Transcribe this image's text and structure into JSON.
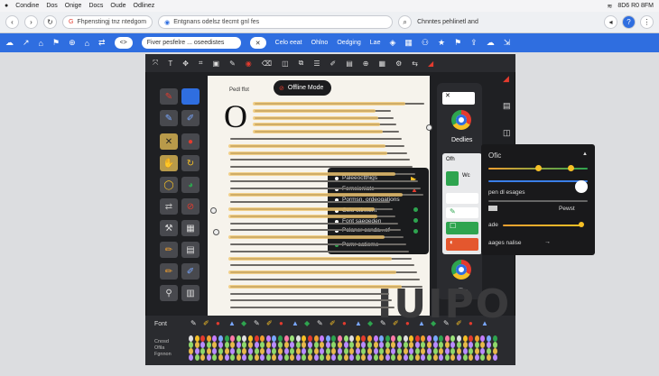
{
  "os_menu": {
    "items": [
      "Condine",
      "Dos",
      "Onige",
      "Docs",
      "Oude",
      "Odlinez"
    ],
    "status": "8D6 R0 8FM"
  },
  "address_bar": {
    "tab_text": "Fhpenstingj tnz ntedgom",
    "url": "Entgnans odelsz tlecmt gnl fes",
    "tab2_text": "Chnntes pehlinetl and"
  },
  "blue_toolbar": {
    "search_text": "Fiver pesfelre ... oseedistes",
    "labels": [
      "Celo eeat",
      "Ohlno",
      "Oedging",
      "Lae"
    ]
  },
  "document": {
    "header": "Pedl ffot",
    "dropcap": "O",
    "offline_badge": "Offline Mode"
  },
  "context_menu": {
    "items": [
      "Paleeoctthigs",
      "Fornsioniate",
      "Pormsn, ordeogations",
      "Celo otinnent",
      "Font saegeden",
      "Polaner osnda...ef",
      "Pomr oatieme"
    ]
  },
  "right_column": {
    "label_top": "Dedlies",
    "label_bottom": "Offhr"
  },
  "slide_panel": {
    "items": [
      "Ofh",
      "Wc",
      ""
    ]
  },
  "settings": {
    "title": "Ofic",
    "label1": "pen dl esages",
    "label2": "Pewst",
    "label3": "ade",
    "label4": "aages nalise"
  },
  "bottom_bar": {
    "labels": [
      "Font",
      "Cnosd",
      "Ofila",
      "Fgnnon"
    ]
  },
  "watermark": "IUIPO",
  "colors": {
    "accent": "#2f6ee0",
    "highlight": "#f0c46a",
    "dark": "#1f2023"
  }
}
